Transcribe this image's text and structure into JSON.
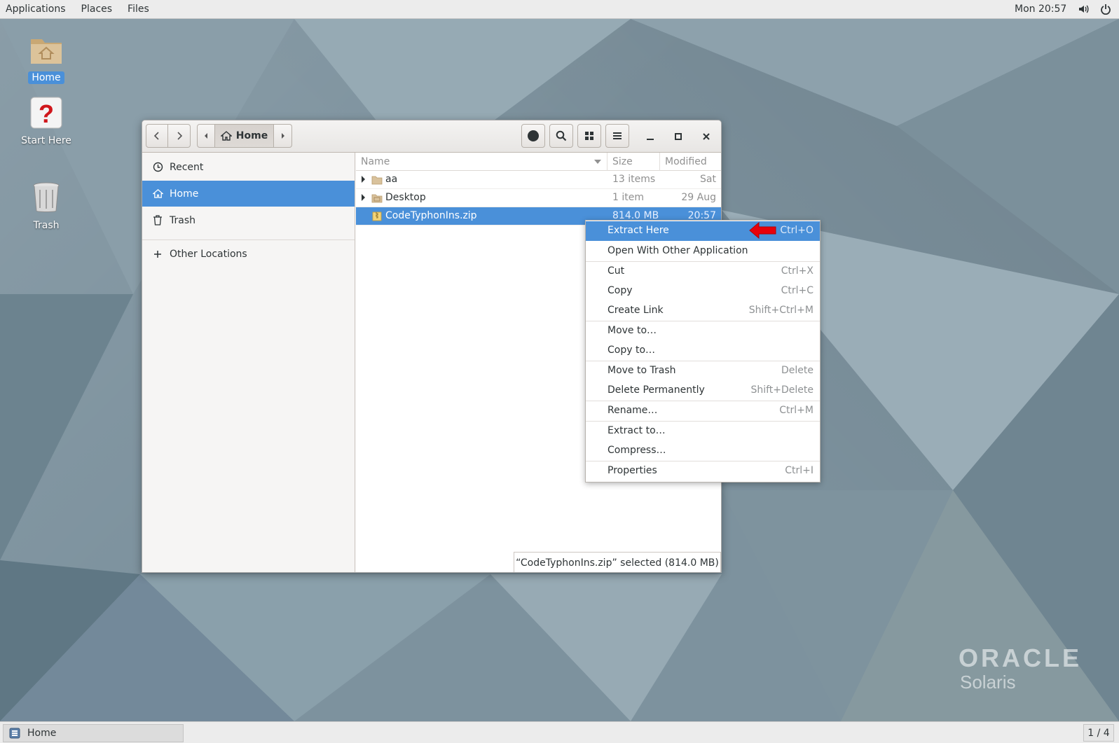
{
  "topbar": {
    "menus": [
      "Applications",
      "Places",
      "Files"
    ],
    "clock": "Mon 20:57",
    "icons": [
      "volume-icon",
      "power-icon"
    ]
  },
  "desktop": {
    "icons": [
      {
        "label": "Home",
        "icon": "home-folder-icon",
        "selected": true
      },
      {
        "label": "Start Here",
        "icon": "help-icon",
        "selected": false
      },
      {
        "label": "Trash",
        "icon": "trash-icon",
        "selected": false
      }
    ]
  },
  "window": {
    "path": {
      "current": "Home"
    },
    "sidebar": {
      "items": [
        {
          "label": "Recent",
          "icon": "clock-icon"
        },
        {
          "label": "Home",
          "icon": "home-icon",
          "active": true
        },
        {
          "label": "Trash",
          "icon": "trash-icon"
        },
        {
          "label": "Other Locations",
          "icon": "plus-icon"
        }
      ]
    },
    "columns": {
      "name": "Name",
      "size": "Size",
      "modified": "Modified"
    },
    "files": [
      {
        "name": "aa",
        "size": "13 items",
        "modified": "Sat",
        "type": "folder",
        "expandable": true
      },
      {
        "name": "Desktop",
        "size": "1 item",
        "modified": "29 Aug",
        "type": "desktop-folder",
        "expandable": true
      },
      {
        "name": "CodeTyphonIns.zip",
        "size": "814.0 MB",
        "modified": "20:57",
        "type": "archive",
        "selected": true
      }
    ],
    "status": "“CodeTyphonIns.zip” selected  (814.0 MB)"
  },
  "context_menu": {
    "items": [
      {
        "label": "Extract Here",
        "shortcut": "Ctrl+O",
        "highlighted": true
      },
      {
        "label": "Open With Other Application",
        "shortcut": ""
      },
      {
        "label": "Cut",
        "shortcut": "Ctrl+X"
      },
      {
        "label": "Copy",
        "shortcut": "Ctrl+C"
      },
      {
        "label": "Create Link",
        "shortcut": "Shift+Ctrl+M"
      },
      {
        "label": "Move to…",
        "shortcut": ""
      },
      {
        "label": "Copy to…",
        "shortcut": ""
      },
      {
        "label": "Move to Trash",
        "shortcut": "Delete"
      },
      {
        "label": "Delete Permanently",
        "shortcut": "Shift+Delete"
      },
      {
        "label": "Rename…",
        "shortcut": "Ctrl+M"
      },
      {
        "label": "Extract to…",
        "shortcut": ""
      },
      {
        "label": "Compress…",
        "shortcut": ""
      },
      {
        "label": "Properties",
        "shortcut": "Ctrl+I"
      }
    ]
  },
  "branding": {
    "line1": "ORACLE",
    "line2": "Solaris"
  },
  "taskbar": {
    "task_label": "Home",
    "workspace": "1 / 4"
  },
  "colors": {
    "accent": "#4a90d9",
    "arrow": "#e8000b",
    "panel": "#ececec"
  }
}
